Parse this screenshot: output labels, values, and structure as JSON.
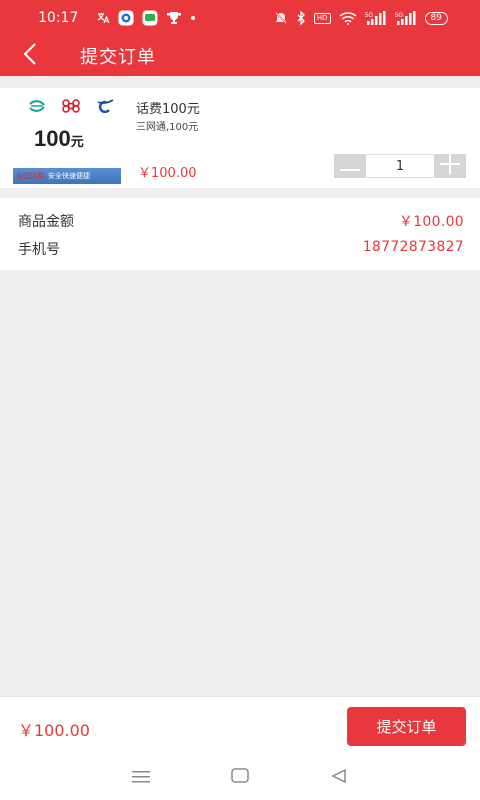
{
  "status_bar": {
    "time": "10:17",
    "network_1": "5G",
    "network_2": "5G",
    "hd_badge": "HD",
    "battery": "89"
  },
  "header": {
    "title": "提交订单"
  },
  "product": {
    "thumb_amount": "100",
    "thumb_unit": "元",
    "thumb_banner_left": "全国话费",
    "thumb_banner_right": "安全快速便捷",
    "name": "话费100元",
    "subtitle": "三网通,100元",
    "price": "￥100.00",
    "quantity": "1"
  },
  "summary": {
    "amount_label": "商品金额",
    "amount_value": "￥100.00",
    "phone_label": "手机号",
    "phone_value": "18772873827"
  },
  "footer": {
    "total": "￥100.00",
    "submit_label": "提交订单"
  },
  "icons": {
    "back": "chevron-left-icon",
    "minus": "minus-icon",
    "plus": "plus-icon",
    "nav_menu": "menu-icon",
    "nav_home": "home-square-icon",
    "nav_back": "triangle-back-icon"
  },
  "colors": {
    "brand": "#e8383d",
    "background": "#efefef",
    "stepper_button": "#d6d6d6"
  }
}
